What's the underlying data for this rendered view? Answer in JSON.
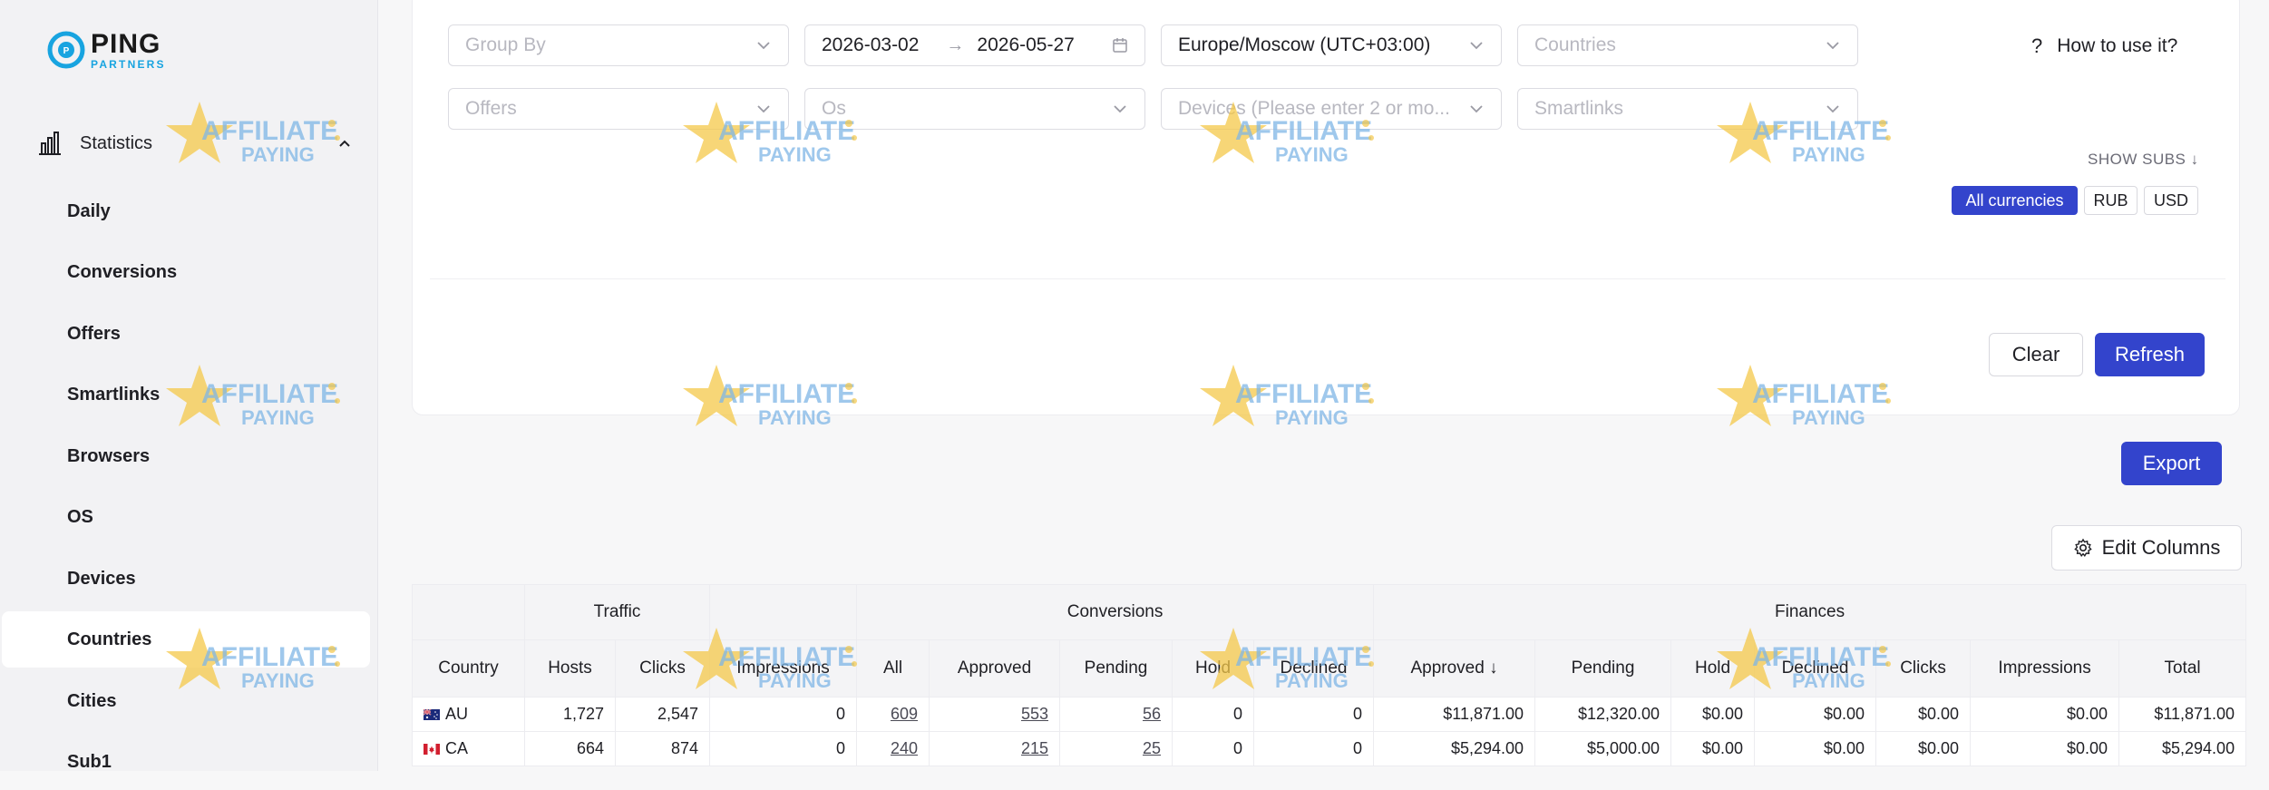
{
  "brand": {
    "name": "PING",
    "sub": "PARTNERS"
  },
  "sidebar": {
    "section_label": "Statistics",
    "items": [
      {
        "label": "Daily",
        "active": false
      },
      {
        "label": "Conversions",
        "active": false
      },
      {
        "label": "Offers",
        "active": false
      },
      {
        "label": "Smartlinks",
        "active": false
      },
      {
        "label": "Browsers",
        "active": false
      },
      {
        "label": "OS",
        "active": false
      },
      {
        "label": "Devices",
        "active": false
      },
      {
        "label": "Countries",
        "active": true
      },
      {
        "label": "Cities",
        "active": false
      },
      {
        "label": "Sub1",
        "active": false
      }
    ]
  },
  "filters": {
    "group_by": "Group By",
    "date_from": "2026-03-02",
    "date_to": "2026-05-27",
    "timezone": "Europe/Moscow (UTC+03:00)",
    "countries": "Countries",
    "offers": "Offers",
    "os": "Os",
    "devices": "Devices (Please enter 2 or mo...",
    "smartlinks": "Smartlinks"
  },
  "help_label": "How to use it?",
  "show_subs_label": "SHOW SUBS",
  "currencies": [
    "All currencies",
    "RUB",
    "USD"
  ],
  "selected_currency": "All currencies",
  "actions": {
    "clear": "Clear",
    "refresh": "Refresh",
    "export": "Export",
    "edit_columns": "Edit Columns"
  },
  "watermark": {
    "line1": "AFFILIATE",
    "line2": "PAYING"
  },
  "table": {
    "groups": {
      "traffic": "Traffic",
      "conversions": "Conversions",
      "finances": "Finances"
    },
    "columns": [
      "Country",
      "Hosts",
      "Clicks",
      "Impressions",
      "All",
      "Approved",
      "Pending",
      "Hold",
      "Declined",
      "Approved",
      "Pending",
      "Hold",
      "Declined",
      "Clicks",
      "Impressions",
      "Total"
    ],
    "rows": [
      [
        "AU",
        "1,727",
        "2,547",
        "0",
        "609",
        "553",
        "56",
        "0",
        "0",
        "$11,871.00",
        "$12,320.00",
        "$0.00",
        "$0.00",
        "$0.00",
        "$0.00",
        "$11,871.00"
      ],
      [
        "CA",
        "664",
        "874",
        "0",
        "240",
        "215",
        "25",
        "0",
        "0",
        "$5,294.00",
        "$5,000.00",
        "$0.00",
        "$0.00",
        "$0.00",
        "$0.00",
        "$5,294.00"
      ]
    ]
  },
  "colors": {
    "accent": "#3344cc",
    "brand_blue": "#18a4e0"
  }
}
